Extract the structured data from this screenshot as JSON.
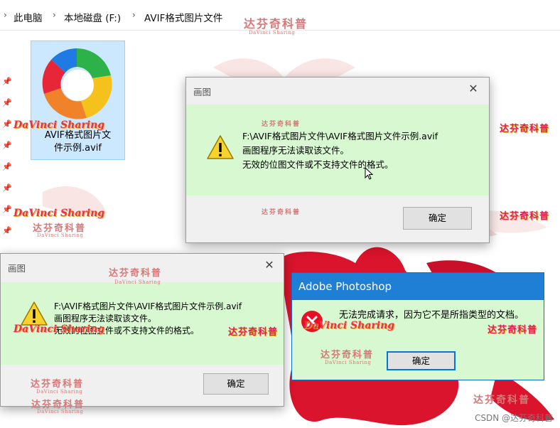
{
  "breadcrumb": {
    "items": [
      "此电脑",
      "本地磁盘 (F:)",
      "AVIF格式图片文件"
    ],
    "separator": "›"
  },
  "file": {
    "name_line1": "AVIF格式图片文",
    "name_line2": "件示例.avif",
    "icon": "avif-file-icon"
  },
  "paint_dialog_1": {
    "title": "画图",
    "message_line1": "F:\\AVIF格式图片文件\\AVIF格式图片文件示例.avif",
    "message_line2": "画图程序无法读取该文件。",
    "message_line3": "无效的位图文件或不支持文件的格式。",
    "ok_label": "确定",
    "close_label": "✕"
  },
  "paint_dialog_2": {
    "title": "画图",
    "message_line1": "F:\\AVIF格式图片文件\\AVIF格式图片文件示例.avif",
    "message_line2": "画图程序无法读取该文件。",
    "message_line3": "无效的位图文件或不支持文件的格式。",
    "ok_label": "确定",
    "close_label": "✕"
  },
  "photoshop_dialog": {
    "title": "Adobe Photoshop",
    "message": "无法完成请求，因为它不是所指类型的文档。",
    "ok_label": "确定"
  },
  "watermarks": {
    "cn": "达芬奇科普",
    "en": "DaVinci Sharing",
    "davinci": "DaVinci Sharing"
  },
  "footer": {
    "csdn": "CSDN @达芬奇科普"
  },
  "colors": {
    "dialog_highlight": "#d7f8d0",
    "photoshop_title": "#1e7fd5",
    "watermark": "#e8324c"
  }
}
